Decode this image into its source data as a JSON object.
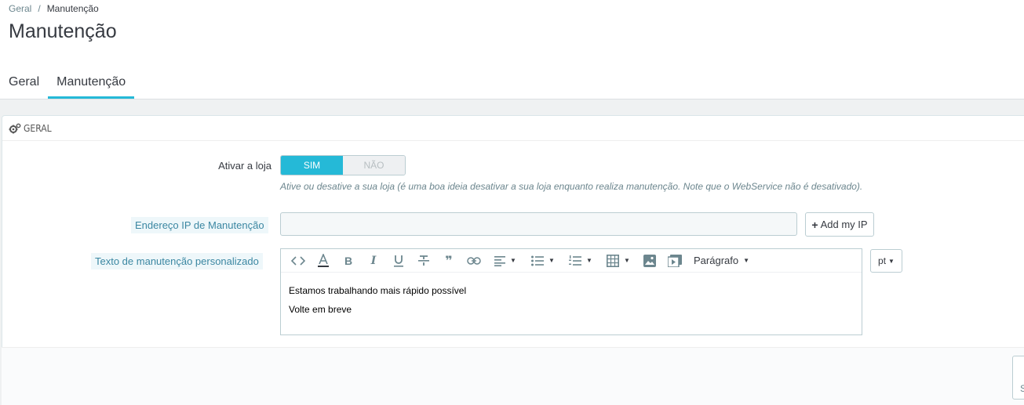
{
  "breadcrumb": {
    "parent": "Geral",
    "separator": "/",
    "current": "Manutenção"
  },
  "page_title": "Manutenção",
  "tabs": [
    {
      "label": "Geral",
      "active": false
    },
    {
      "label": "Manutenção",
      "active": true
    }
  ],
  "panel": {
    "heading": "GERAL",
    "heading_icon": "cogs-icon"
  },
  "shop_toggle": {
    "label": "Ativar a loja",
    "on_label": "SIM",
    "off_label": "NÃO",
    "selected": "SIM",
    "help": "Ative ou desative a sua loja (é uma boa ideia desativar a sua loja enquanto realiza manutenção. Note que o WebService não é desativado)."
  },
  "ip_field": {
    "label": "Endereço IP de Manutenção",
    "value": "",
    "add_button": "Add my IP"
  },
  "custom_text": {
    "label": "Texto de manutenção personalizado",
    "format_label": "Parágrafo",
    "lines": [
      "Estamos trabalhando mais rápido possível",
      "Volte em breve"
    ],
    "language": "pt"
  },
  "footer": {
    "save_label": "S"
  },
  "colors": {
    "accent": "#25b9d7",
    "hint_bg": "#eef7fa",
    "hint_text": "#3b87a2"
  }
}
